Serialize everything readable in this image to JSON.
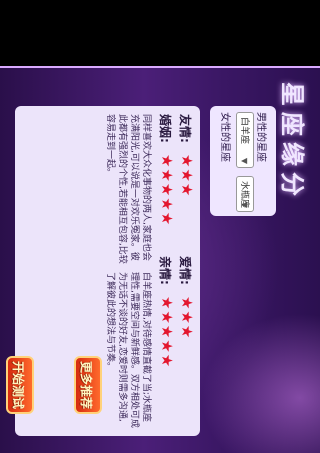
{
  "app": {
    "title": "星座缘分"
  },
  "form": {
    "male_label": "男性的星座",
    "female_label": "女性的星座",
    "male_value": "白羊座",
    "female_value": "水瓶座"
  },
  "result": {
    "friendship_label": "友情:",
    "friendship_stars": "★★★",
    "love_label": "爱情:",
    "love_stars": "★★★",
    "marriage_label": "婚姻:",
    "marriage_stars": "★★★★★",
    "affection_label": "亲情:",
    "affection_stars": "★★★★★",
    "friendship_text": "同样喜欢大众化事物的两人,家庭也会充满阳光,可以说是一对欢乐冤家。彼此都有强烈的个性,若能相互包容,比较容易走到一起。",
    "love_text": "白羊座热情,对待感情直截了当;水瓶座理性,需要空间与新鲜感。双方相处可成为无话不谈的好友,恋爱时则需多沟通,了解彼此的想法与节奏。"
  },
  "buttons": {
    "test": "开始测试",
    "more": "更多推荐"
  },
  "colors": {
    "star": "#e3172f",
    "background": "#3a1764",
    "panel": "#ece4fa"
  }
}
